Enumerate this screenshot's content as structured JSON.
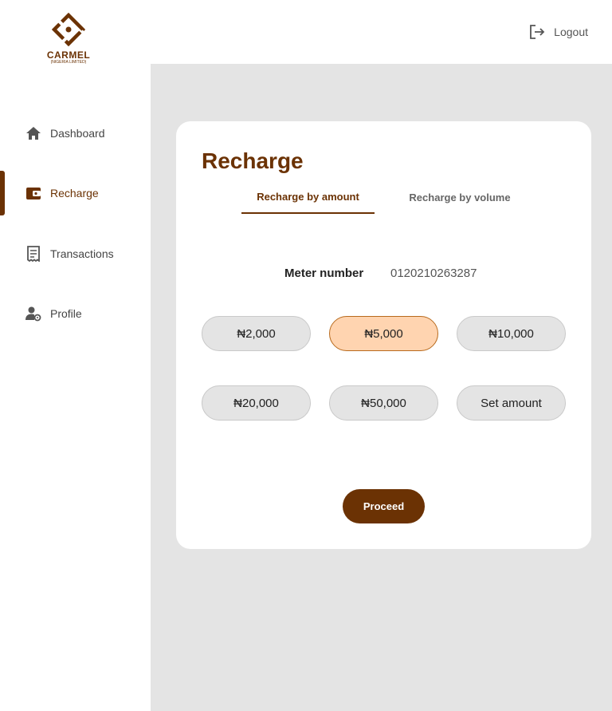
{
  "brand": {
    "logo_word": "CARMEL",
    "logo_sub": "(NIGERIA LIMITED)",
    "color": "#6b3204"
  },
  "header": {
    "logout_label": "Logout",
    "logout_icon": "logout-icon"
  },
  "sidebar": {
    "items": [
      {
        "label": "Dashboard",
        "icon": "home-icon",
        "active": false
      },
      {
        "label": "Recharge",
        "icon": "wallet-icon",
        "active": true
      },
      {
        "label": "Transactions",
        "icon": "receipt-icon",
        "active": false
      },
      {
        "label": "Profile",
        "icon": "user-settings-icon",
        "active": false
      }
    ]
  },
  "recharge": {
    "title": "Recharge",
    "tabs": [
      {
        "label": "Recharge by amount",
        "active": true
      },
      {
        "label": "Recharge by volume",
        "active": false
      }
    ],
    "meter_label": "Meter number",
    "meter_value": "0120210263287",
    "amounts": [
      {
        "label": "₦2,000",
        "selected": false
      },
      {
        "label": "₦5,000",
        "selected": true
      },
      {
        "label": "₦10,000",
        "selected": false
      },
      {
        "label": "₦20,000",
        "selected": false
      },
      {
        "label": "₦50,000",
        "selected": false
      },
      {
        "label": "Set amount",
        "selected": false
      }
    ],
    "proceed_label": "Proceed"
  },
  "colors": {
    "accent": "#6b3204",
    "selected_fill": "#ffd4b0",
    "background": "#e4e4e4"
  }
}
